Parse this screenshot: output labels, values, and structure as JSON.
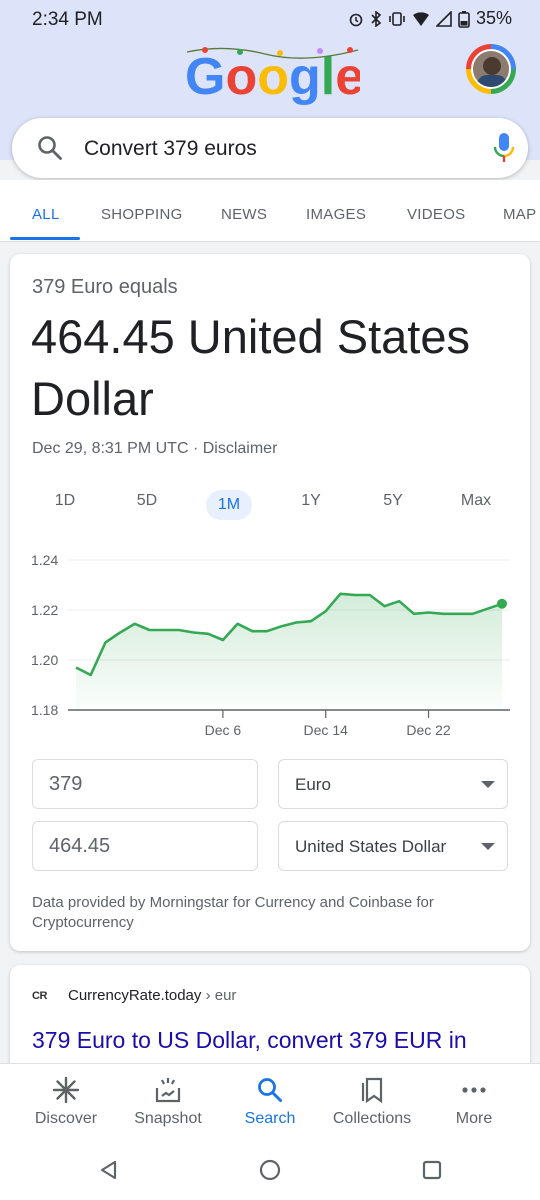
{
  "status_bar": {
    "time": "2:34 PM",
    "battery": "35%"
  },
  "search": {
    "query": "Convert 379 euros"
  },
  "tabs": [
    {
      "label": "ALL",
      "active": true
    },
    {
      "label": "SHOPPING"
    },
    {
      "label": "NEWS"
    },
    {
      "label": "IMAGES"
    },
    {
      "label": "VIDEOS"
    },
    {
      "label": "MAP"
    }
  ],
  "converter": {
    "equals_line": "379 Euro equals",
    "result_line": "464.45 United States Dollar",
    "updated": "Dec 29, 8:31 PM UTC · Disclaimer",
    "ranges": [
      "1D",
      "5D",
      "1M",
      "1Y",
      "5Y",
      "Max"
    ],
    "active_range": "1M",
    "from_amount": "379",
    "from_currency": "Euro",
    "to_amount": "464.45",
    "to_currency": "United States Dollar",
    "credit": "Data provided by Morningstar for Currency and Coinbase for Cryptocurrency"
  },
  "chart_data": {
    "type": "area",
    "yticks": [
      "1.24",
      "1.22",
      "1.20",
      "1.18"
    ],
    "xticks": [
      "Dec 6",
      "Dec 14",
      "Dec 22"
    ],
    "ylim": [
      1.18,
      1.24
    ],
    "series_color": "#34a853",
    "values": [
      1.197,
      1.194,
      1.207,
      1.211,
      1.2145,
      1.212,
      1.212,
      1.212,
      1.211,
      1.2105,
      1.208,
      1.2145,
      1.2115,
      1.2115,
      1.2135,
      1.215,
      1.2155,
      1.2195,
      1.2265,
      1.226,
      1.226,
      1.2215,
      1.2235,
      1.2185,
      1.219,
      1.2185,
      1.2185,
      1.2185,
      1.2205,
      1.2225
    ]
  },
  "result2": {
    "site": "CurrencyRate.today",
    "crumb": " › eur",
    "title": "379 Euro to US Dollar, convert 379 EUR in"
  },
  "bottom_nav": [
    {
      "label": "Discover"
    },
    {
      "label": "Snapshot"
    },
    {
      "label": "Search",
      "active": true
    },
    {
      "label": "Collections"
    },
    {
      "label": "More"
    }
  ],
  "colors": {
    "accent": "#1a73e8",
    "chart_line": "#34a853",
    "link": "#1a0dab"
  }
}
